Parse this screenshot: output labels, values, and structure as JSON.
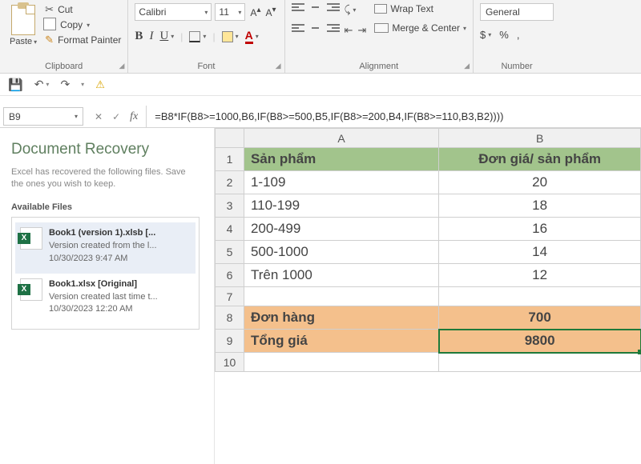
{
  "ribbon": {
    "clipboard": {
      "paste": "Paste",
      "cut": "Cut",
      "copy": "Copy",
      "format_painter": "Format Painter",
      "group_label": "Clipboard"
    },
    "font": {
      "name": "Calibri",
      "size": "11",
      "group_label": "Font"
    },
    "alignment": {
      "wrap": "Wrap Text",
      "merge": "Merge & Center",
      "group_label": "Alignment"
    },
    "number": {
      "format": "General",
      "currency": "$",
      "percent": "%",
      "comma": ",",
      "group_label": "Number"
    }
  },
  "formula_bar": {
    "cell_ref": "B9",
    "formula": "=B8*IF(B8>=1000,B6,IF(B8>=500,B5,IF(B8>=200,B4,IF(B8>=110,B3,B2))))"
  },
  "recovery": {
    "title": "Document Recovery",
    "desc": "Excel has recovered the following files. Save the ones you wish to keep.",
    "available_label": "Available Files",
    "files": [
      {
        "name": "Book1 (version 1).xlsb  [...",
        "line2": "Version created from the l...",
        "line3": "10/30/2023 9:47 AM"
      },
      {
        "name": "Book1.xlsx  [Original]",
        "line2": "Version created last time t...",
        "line3": "10/30/2023 12:20 AM"
      }
    ]
  },
  "sheet": {
    "col_headers": [
      "A",
      "B"
    ],
    "rows": [
      {
        "n": "1",
        "a": "Sản phẩm",
        "b": "Đơn giá/ sản phẩm",
        "cls": "hdr-green"
      },
      {
        "n": "2",
        "a": "1-109",
        "b": "20"
      },
      {
        "n": "3",
        "a": "110-199",
        "b": "18"
      },
      {
        "n": "4",
        "a": "200-499",
        "b": "16"
      },
      {
        "n": "5",
        "a": "500-1000",
        "b": "14"
      },
      {
        "n": "6",
        "a": "Trên 1000",
        "b": "12"
      },
      {
        "n": "7",
        "a": "",
        "b": "",
        "blank": true
      },
      {
        "n": "8",
        "a": "Đơn hàng",
        "b": "700",
        "cls": "hdr-orange"
      },
      {
        "n": "9",
        "a": "Tổng giá",
        "b": "9800",
        "cls": "hdr-orange",
        "active_b": true
      },
      {
        "n": "10",
        "a": "",
        "b": "",
        "blank": true
      }
    ]
  }
}
